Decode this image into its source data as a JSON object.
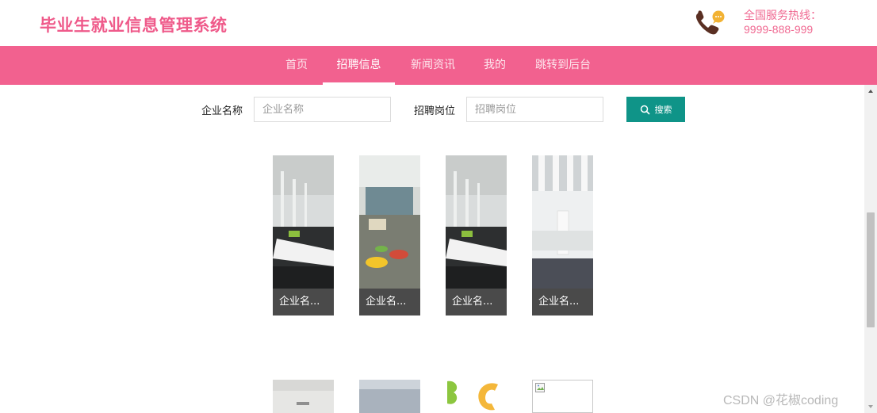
{
  "header": {
    "site_title": "毕业生就业信息管理系统",
    "hotline_label": "全国服务热线：",
    "hotline_number": "9999-888-999",
    "hotline_icon": "phone-chat-icon"
  },
  "nav": {
    "items": [
      {
        "label": "首页",
        "active": false
      },
      {
        "label": "招聘信息",
        "active": true
      },
      {
        "label": "新闻资讯",
        "active": false
      },
      {
        "label": "我的",
        "active": false
      },
      {
        "label": "跳转到后台",
        "active": false
      }
    ]
  },
  "search": {
    "company_label": "企业名称",
    "company_placeholder": "企业名称",
    "position_label": "招聘岗位",
    "position_placeholder": "招聘岗位",
    "button_label": "搜索",
    "button_icon": "search-icon"
  },
  "cards": [
    {
      "label": "企业名..."
    },
    {
      "label": "企业名..."
    },
    {
      "label": "企业名..."
    },
    {
      "label": "企业名..."
    }
  ],
  "watermark": "CSDN @花椒coding",
  "colors": {
    "brand_pink": "#f2618f",
    "title_pink": "#ef5a8a",
    "search_button": "#0f9488",
    "card_label_bg": "#4a4a4a"
  }
}
